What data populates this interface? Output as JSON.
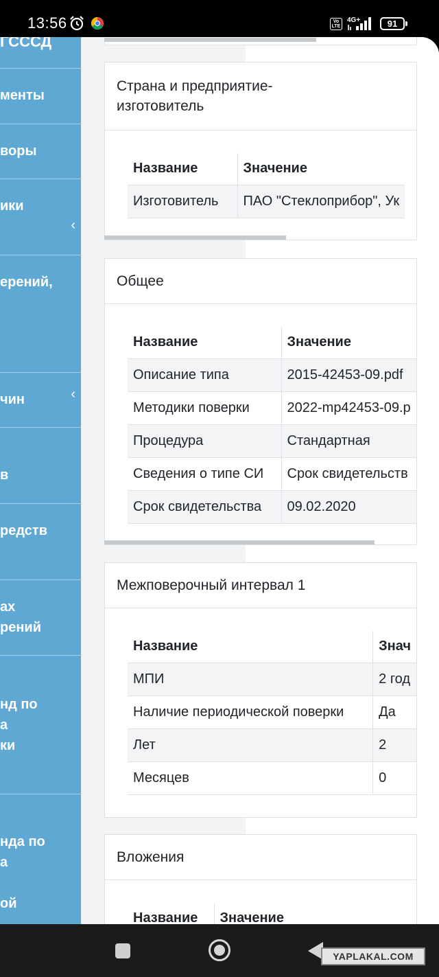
{
  "status_bar": {
    "time": "13:56",
    "battery": "91",
    "volte": "Vo LTE",
    "network": "4G+"
  },
  "sidebar": {
    "header": "ГСССД",
    "items": [
      {
        "label": "менты",
        "chevron": ""
      },
      {
        "label": "воры",
        "chevron": ""
      },
      {
        "label": "ики",
        "chevron": "‹"
      },
      {
        "label": "ерений,",
        "chevron": ""
      },
      {
        "label": "чин",
        "chevron": "‹"
      },
      {
        "label": "в",
        "chevron": ""
      },
      {
        "label": "редств",
        "chevron": ""
      },
      {
        "label": "ах\nрений",
        "chevron": ""
      },
      {
        "label": "нд по\nа\nки",
        "chevron": ""
      },
      {
        "label": "нда по\nа\n\nой",
        "chevron": ""
      }
    ]
  },
  "cards": {
    "country": {
      "title": "Страна и предприятие-\nизготовитель",
      "headers": [
        "Название",
        "Значение"
      ],
      "rows": [
        [
          "Изготовитель",
          "ПАО \"Стеклоприбор\", Ук"
        ]
      ]
    },
    "general": {
      "title": "Общее",
      "headers": [
        "Название",
        "Значение"
      ],
      "rows": [
        [
          "Описание типа",
          "2015-42453-09.pdf"
        ],
        [
          "Методики поверки",
          "2022-mp42453-09.p"
        ],
        [
          "Процедура",
          "Стандартная"
        ],
        [
          "Сведения о типе СИ",
          "Срок свидетельств"
        ],
        [
          "Срок свидетельства",
          "09.02.2020"
        ]
      ]
    },
    "interval": {
      "title": "Межповерочный интервал 1",
      "headers": [
        "Название",
        "Знач"
      ],
      "rows": [
        [
          "МПИ",
          "2 год"
        ],
        [
          "Наличие периодической поверки",
          "Да"
        ],
        [
          "Лет",
          "2"
        ],
        [
          "Месяцев",
          "0"
        ]
      ]
    },
    "attachments": {
      "title": "Вложения",
      "headers": [
        "Название",
        "Значение"
      ]
    }
  },
  "watermark": "YAPLAKAL.COM",
  "colors": {
    "sidebar": "#5fa8d3",
    "card_border": "#dde1e4",
    "row_alt": "#f3f4f5"
  }
}
